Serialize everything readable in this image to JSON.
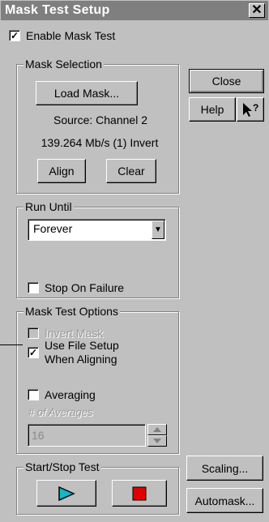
{
  "window": {
    "title": "Mask Test Setup",
    "close_glyph": "✕"
  },
  "enable_mask_test": {
    "label": "Enable Mask Test",
    "checked": true
  },
  "mask_selection": {
    "title": "Mask Selection",
    "load_label": "Load Mask...",
    "source_text": "Source: Channel 2",
    "rate_text": "139.264 Mb/s (1) Invert",
    "align_label": "Align",
    "clear_label": "Clear"
  },
  "side_buttons": {
    "close_label": "Close",
    "help_label": "Help",
    "help_pointer_icon": "arrow-question-icon"
  },
  "run_until": {
    "title": "Run Until",
    "selected": "Forever",
    "stop_on_failure": {
      "label": "Stop On Failure",
      "checked": false
    }
  },
  "mask_test_options": {
    "title": "Mask Test Options",
    "invert_mask": {
      "label": "Invert Mask",
      "checked": false,
      "enabled": false
    },
    "use_file_setup": {
      "label_line1": "Use File Setup",
      "label_line2": "When Aligning",
      "checked": true
    },
    "averaging": {
      "label": "Averaging",
      "checked": false
    },
    "num_averages_label": "# of Averages",
    "num_averages_value": "16"
  },
  "start_stop": {
    "title": "Start/Stop Test",
    "start_icon": "play-triangle-icon",
    "stop_icon": "stop-square-icon"
  },
  "bottom_buttons": {
    "scaling_label": "Scaling...",
    "automask_label": "Automask..."
  },
  "colors": {
    "title_bar": "#7f7f7f",
    "dialog_bg": "#c0c0c0",
    "play": "#12b7c8",
    "stop": "#e00000"
  }
}
